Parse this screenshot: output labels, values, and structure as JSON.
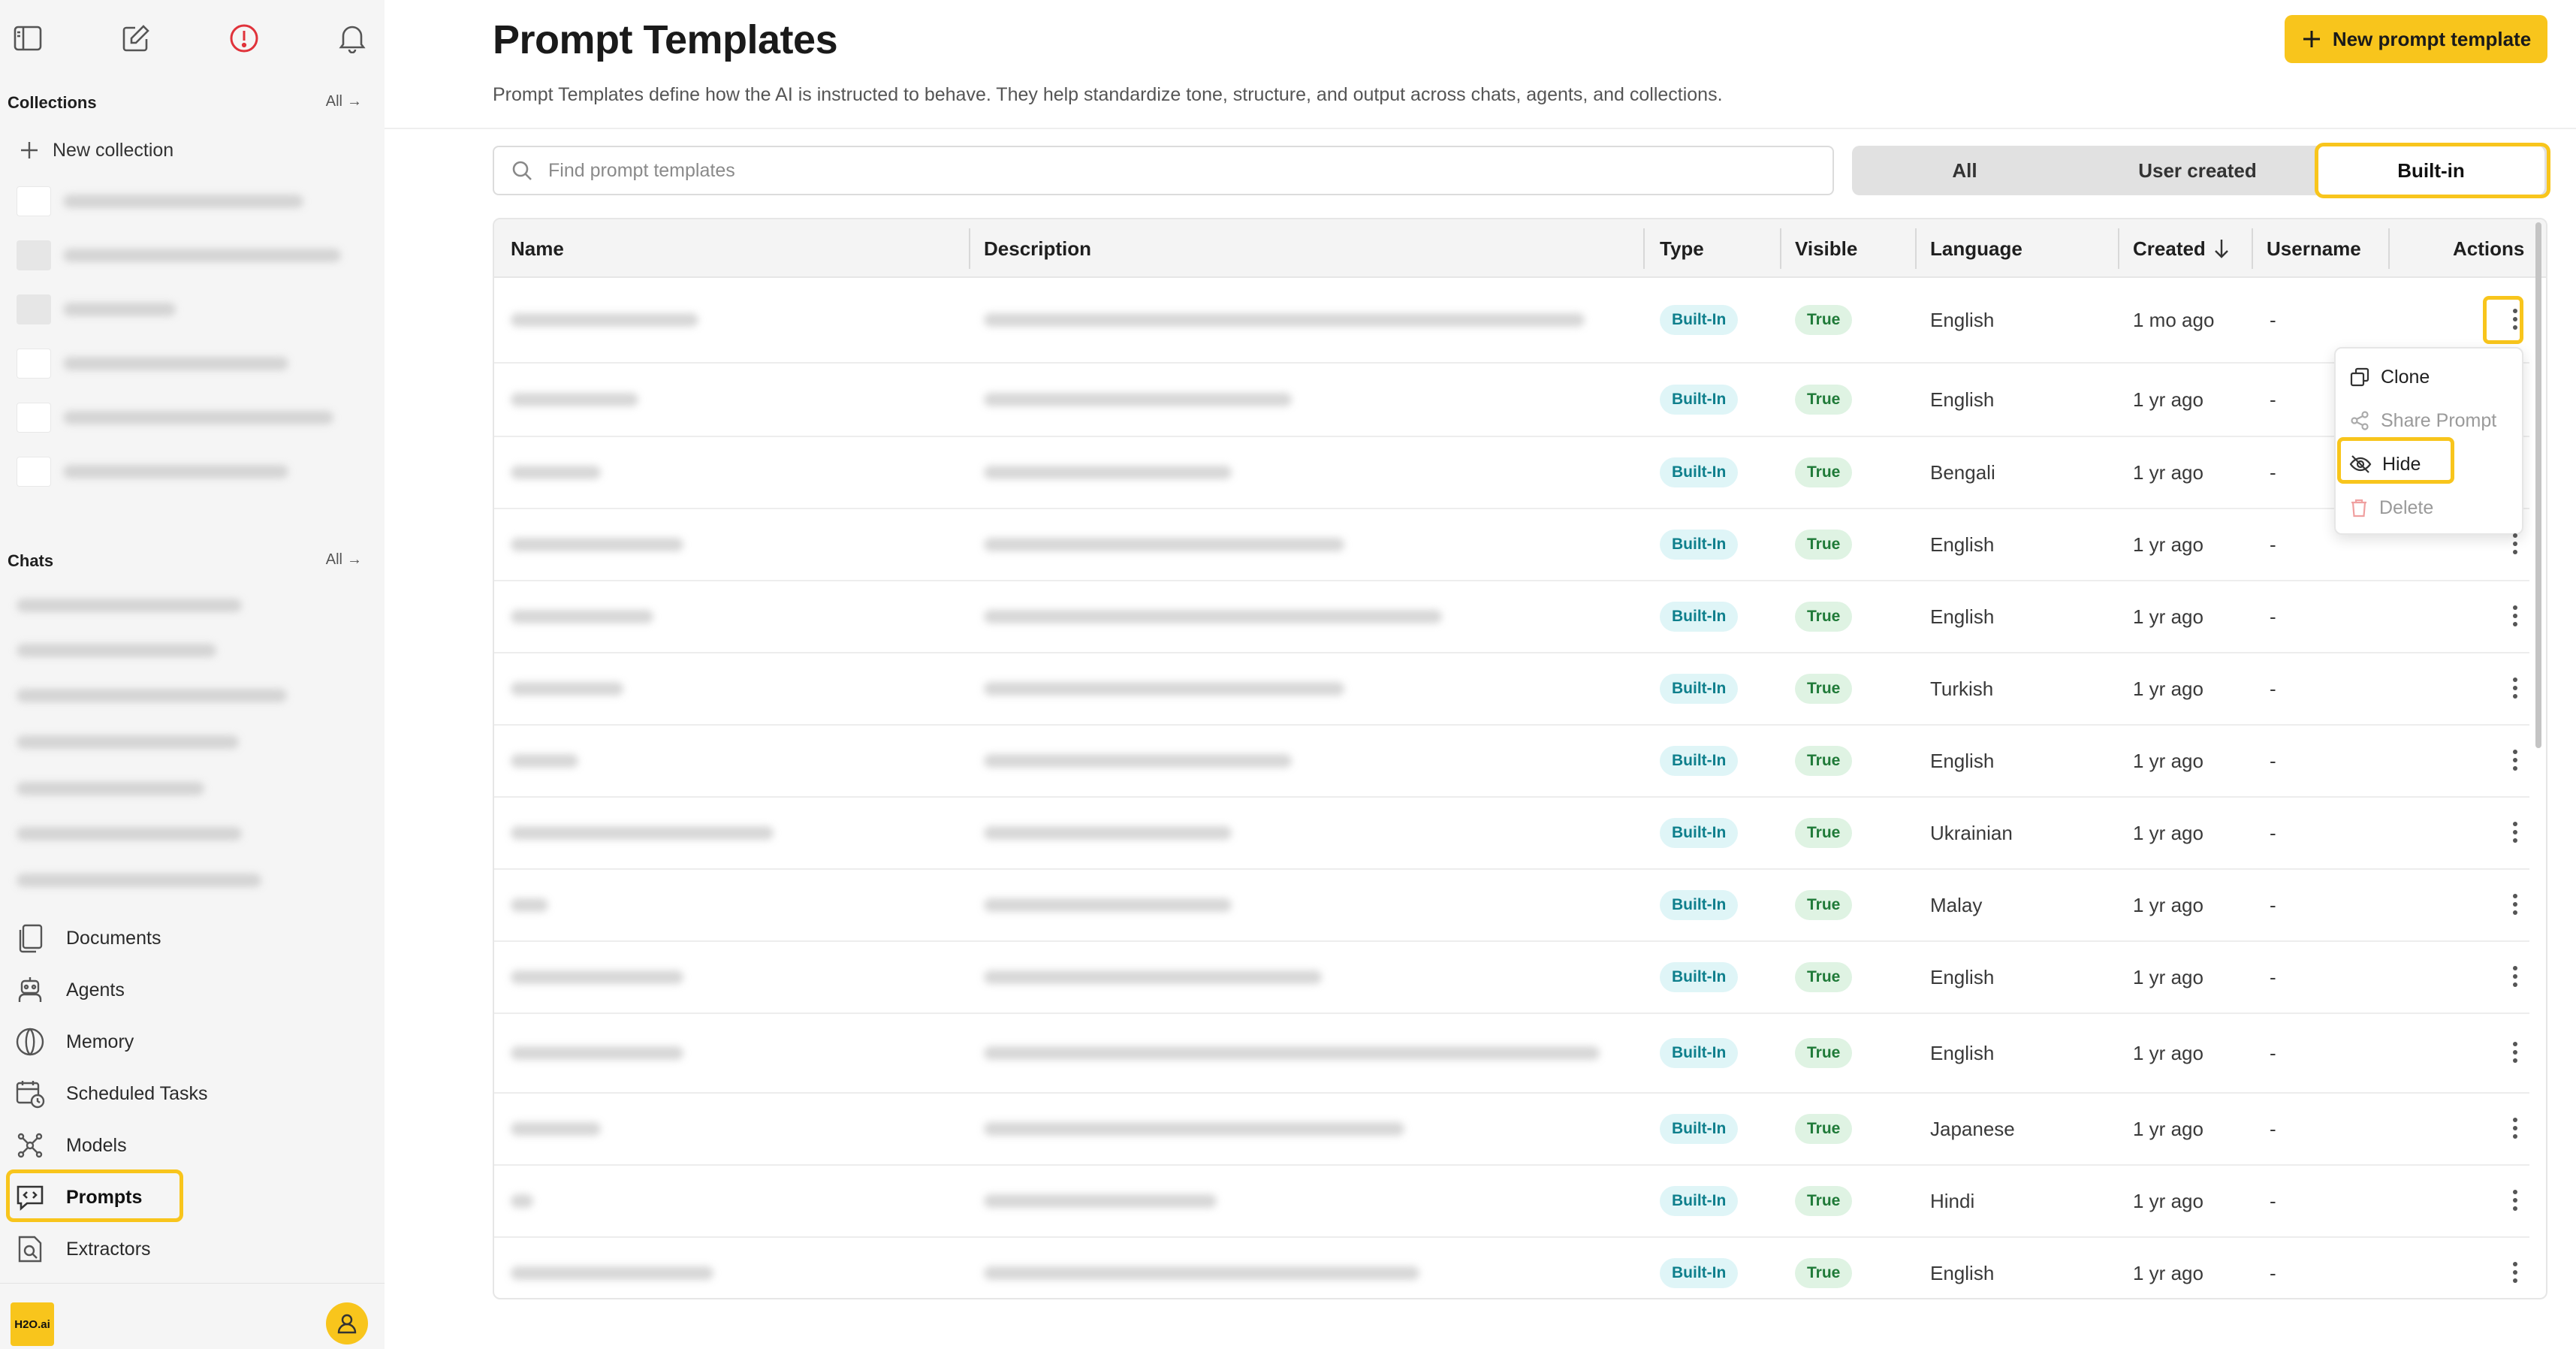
{
  "sidebar": {
    "collections_label": "Collections",
    "collections_all": "All",
    "new_collection": "New collection",
    "chats_label": "Chats",
    "chats_all": "All",
    "nav": {
      "documents": "Documents",
      "agents": "Agents",
      "memory": "Memory",
      "scheduled_tasks": "Scheduled Tasks",
      "models": "Models",
      "prompts": "Prompts",
      "extractors": "Extractors"
    },
    "logo_text": "H2O.ai"
  },
  "header": {
    "title": "Prompt Templates",
    "description": "Prompt Templates define how the AI is instructed to behave. They help standardize tone, structure, and output across chats, agents, and collections.",
    "new_button": "New prompt template"
  },
  "search": {
    "placeholder": "Find prompt templates"
  },
  "filter": {
    "all": "All",
    "user_created": "User created",
    "built_in": "Built-in",
    "selected": "Built-in"
  },
  "table": {
    "columns": {
      "name": "Name",
      "description": "Description",
      "type": "Type",
      "visible": "Visible",
      "language": "Language",
      "created": "Created",
      "username": "Username",
      "actions": "Actions"
    },
    "rows": [
      {
        "type": "Built-In",
        "visible": "True",
        "language": "English",
        "created": "1 mo ago",
        "username": "-"
      },
      {
        "type": "Built-In",
        "visible": "True",
        "language": "English",
        "created": "1 yr ago",
        "username": "-"
      },
      {
        "type": "Built-In",
        "visible": "True",
        "language": "Bengali",
        "created": "1 yr ago",
        "username": "-"
      },
      {
        "type": "Built-In",
        "visible": "True",
        "language": "English",
        "created": "1 yr ago",
        "username": "-"
      },
      {
        "type": "Built-In",
        "visible": "True",
        "language": "English",
        "created": "1 yr ago",
        "username": "-"
      },
      {
        "type": "Built-In",
        "visible": "True",
        "language": "Turkish",
        "created": "1 yr ago",
        "username": "-"
      },
      {
        "type": "Built-In",
        "visible": "True",
        "language": "English",
        "created": "1 yr ago",
        "username": "-"
      },
      {
        "type": "Built-In",
        "visible": "True",
        "language": "Ukrainian",
        "created": "1 yr ago",
        "username": "-"
      },
      {
        "type": "Built-In",
        "visible": "True",
        "language": "Malay",
        "created": "1 yr ago",
        "username": "-"
      },
      {
        "type": "Built-In",
        "visible": "True",
        "language": "English",
        "created": "1 yr ago",
        "username": "-"
      },
      {
        "type": "Built-In",
        "visible": "True",
        "language": "English",
        "created": "1 yr ago",
        "username": "-"
      },
      {
        "type": "Built-In",
        "visible": "True",
        "language": "Japanese",
        "created": "1 yr ago",
        "username": "-"
      },
      {
        "type": "Built-In",
        "visible": "True",
        "language": "Hindi",
        "created": "1 yr ago",
        "username": "-"
      },
      {
        "type": "Built-In",
        "visible": "True",
        "language": "English",
        "created": "1 yr ago",
        "username": "-"
      }
    ]
  },
  "menu": {
    "clone": "Clone",
    "share": "Share Prompt",
    "hide": "Hide",
    "delete": "Delete"
  },
  "colors": {
    "accent": "#f8c51c",
    "sidebar_bg": "#f5f5f5",
    "type_badge_bg": "#dff5f7",
    "visible_badge_bg": "#dff3e3",
    "alert_red": "#e0323a"
  },
  "icons": {
    "sidebar_toggle": "sidebar-toggle-icon",
    "new_chat": "edit-icon",
    "alert": "alert-circle-icon",
    "notifications": "bell-icon",
    "search": "search-icon",
    "plus": "plus-icon",
    "sort_desc": "arrow-down-icon",
    "more": "kebab-icon"
  }
}
